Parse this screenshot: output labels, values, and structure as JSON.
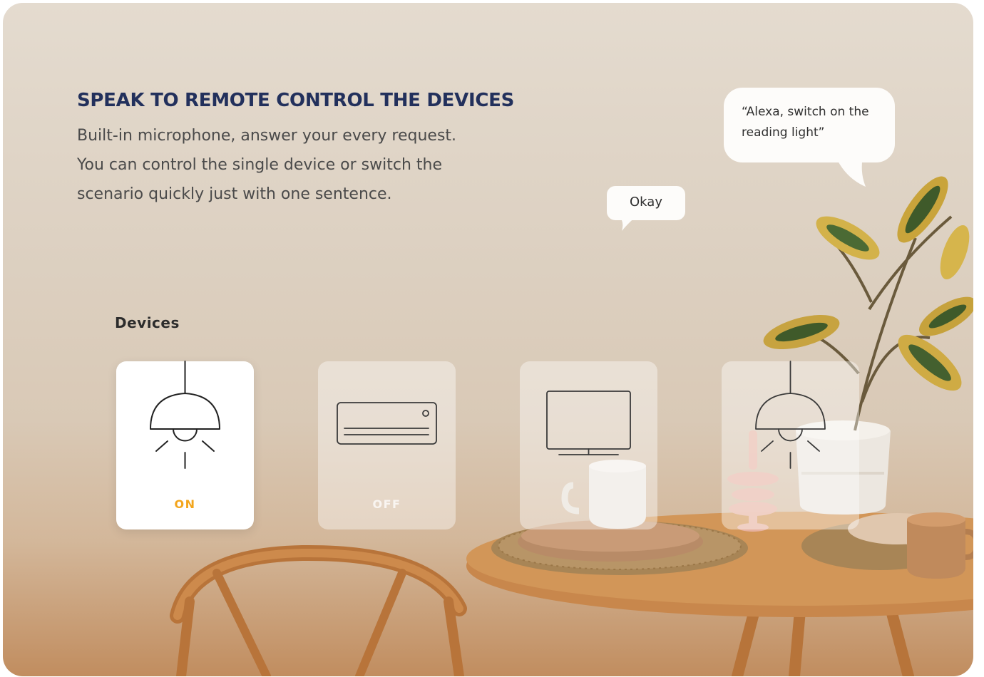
{
  "hero": {
    "title": "SPEAK TO REMOTE CONTROL THE DEVICES",
    "description_lines": [
      "Built-in microphone, answer your every request.",
      "You can control the single device or switch the",
      "scenario quickly just with one sentence."
    ]
  },
  "chat": {
    "user_lines": [
      "“Alexa, switch on the",
      "reading light”"
    ],
    "assistant_reply": "Okay"
  },
  "devices": {
    "label": "Devices",
    "cards": [
      {
        "device": "pendant lamp",
        "icon": "pendant-lamp-icon",
        "state": "ON",
        "active": true
      },
      {
        "device": "air conditioner",
        "icon": "air-conditioner-icon",
        "state": "OFF",
        "active": false
      },
      {
        "device": "television",
        "icon": "tv-icon",
        "state": "",
        "active": false
      },
      {
        "device": "pendant lamp",
        "icon": "pendant-lamp-icon",
        "state": "",
        "active": false
      }
    ]
  },
  "colors": {
    "headline": "#22305c",
    "on_state": "#f3a51c",
    "background": "#e0d6ca"
  }
}
